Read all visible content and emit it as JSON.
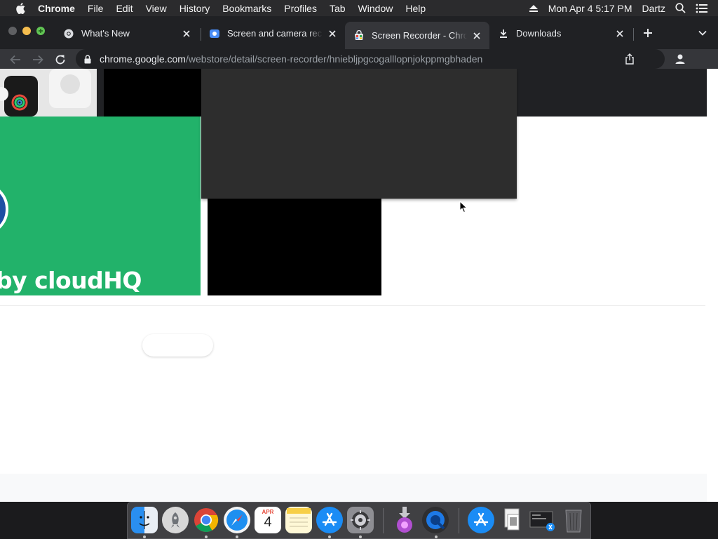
{
  "menubar": {
    "app_name": "Chrome",
    "items": [
      "File",
      "Edit",
      "View",
      "History",
      "Bookmarks",
      "Profiles",
      "Tab",
      "Window",
      "Help"
    ],
    "datetime": "Mon Apr 4  5:17 PM",
    "user": "Dartz"
  },
  "tabs": [
    {
      "title": "What's New",
      "icon": "chrome-icon",
      "active": false
    },
    {
      "title": "Screen and camera recorder",
      "icon": "screen-recorder-icon",
      "active": false
    },
    {
      "title": "Screen Recorder - Chrome Web Store",
      "icon": "web-store-icon",
      "active": true
    },
    {
      "title": "Downloads",
      "icon": "download-icon",
      "active": false
    }
  ],
  "address_bar": {
    "host": "chrome.google.com",
    "path": "/webstore/detail/screen-recorder/hniebljpgcogalllopnjokppmgbhaden"
  },
  "page": {
    "promo_text": "by cloudHQ"
  },
  "colors": {
    "promo_green": "#22b26a",
    "tab_active": "#35363a",
    "tabstrip": "#202124"
  },
  "dock": {
    "apps": [
      "Finder",
      "Launchpad",
      "Google Chrome",
      "Safari",
      "Calendar",
      "Notes",
      "App Store",
      "System Preferences",
      "Downloads",
      "Screen Recorder",
      "App Store",
      "Preview",
      "Screenshots",
      "Trash"
    ],
    "calendar_month": "APR",
    "calendar_day": "4"
  }
}
